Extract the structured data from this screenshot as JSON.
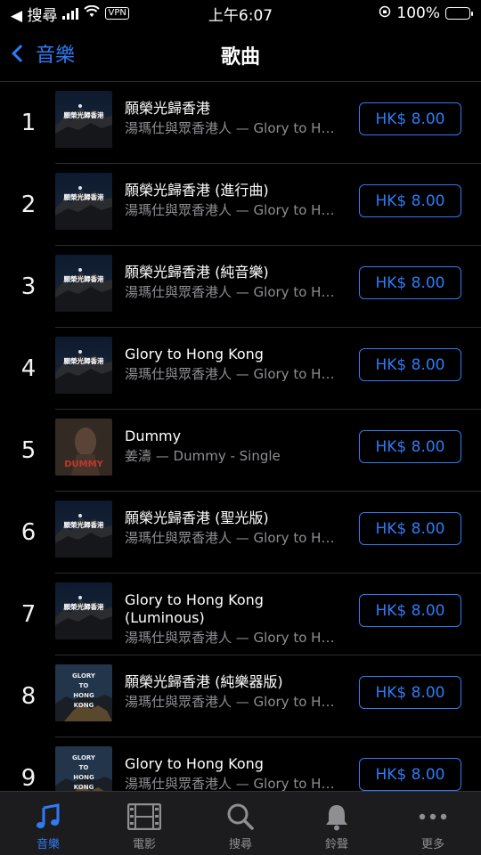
{
  "status_bar": {
    "carrier": "◀ 搜尋",
    "vpn": "VPN",
    "time": "上午6:07",
    "battery_percent": "100%",
    "battery_level": 1.0
  },
  "nav": {
    "back_label": "音樂",
    "title": "歌曲"
  },
  "songs": [
    {
      "rank": "1",
      "title": "願榮光歸香港",
      "subtitle": "湯瑪仕與眾香港人 — Glory to Hong Kong",
      "price": "HK$ 8.00",
      "art": "mountain"
    },
    {
      "rank": "2",
      "title": "願榮光歸香港 (進行曲)",
      "subtitle": "湯瑪仕與眾香港人 — Glory to Hong Kong",
      "price": "HK$ 8.00",
      "art": "mountain"
    },
    {
      "rank": "3",
      "title": "願榮光歸香港 (純音樂)",
      "subtitle": "湯瑪仕與眾香港人 — Glory to Hong Kong",
      "price": "HK$ 8.00",
      "art": "mountain"
    },
    {
      "rank": "4",
      "title": "Glory to Hong Kong",
      "subtitle": "湯瑪仕與眾香港人 — Glory to Hong Kong",
      "price": "HK$ 8.00",
      "art": "mountain"
    },
    {
      "rank": "5",
      "title": "Dummy",
      "subtitle": "姜濤 — Dummy - Single",
      "price": "HK$ 8.00",
      "art": "dummy"
    },
    {
      "rank": "6",
      "title": "願榮光歸香港 (聖光版)",
      "subtitle": "湯瑪仕與眾香港人 — Glory to Hong Kong",
      "price": "HK$ 8.00",
      "art": "mountain"
    },
    {
      "rank": "7",
      "title": "Glory to Hong Kong (Luminous)",
      "subtitle": "湯瑪仕與眾香港人 — Glory to Hong Kong",
      "price": "HK$ 8.00",
      "art": "mountain"
    },
    {
      "rank": "8",
      "title": "願榮光歸香港 (純樂器版)",
      "subtitle": "湯瑪仕與眾香港人 — Glory to Hong Kong",
      "price": "HK$ 8.00",
      "art": "glory-text"
    },
    {
      "rank": "9",
      "title": "Glory to Hong Kong",
      "subtitle": "湯瑪仕與眾香港人 — Glory to Hong Kong",
      "price": "HK$ 8.00",
      "art": "glory-text"
    }
  ],
  "art_text": {
    "mountain": "願榮光歸香港",
    "dummy": "DUMMY",
    "glory": [
      "GLORY",
      "TO",
      "HONG",
      "KONG"
    ]
  },
  "tab_bar": {
    "tabs": [
      {
        "label": "音樂",
        "icon": "music-note-icon",
        "active": true
      },
      {
        "label": "電影",
        "icon": "film-icon",
        "active": false
      },
      {
        "label": "搜尋",
        "icon": "search-icon",
        "active": false
      },
      {
        "label": "鈴聲",
        "icon": "bell-icon",
        "active": false
      },
      {
        "label": "更多",
        "icon": "more-icon",
        "active": false
      }
    ]
  },
  "colors": {
    "accent": "#2f7bf6",
    "background": "#000000",
    "secondary_text": "#8e8e93",
    "tab_bar_bg": "#1c1c1e",
    "battery": "#4cd964"
  }
}
